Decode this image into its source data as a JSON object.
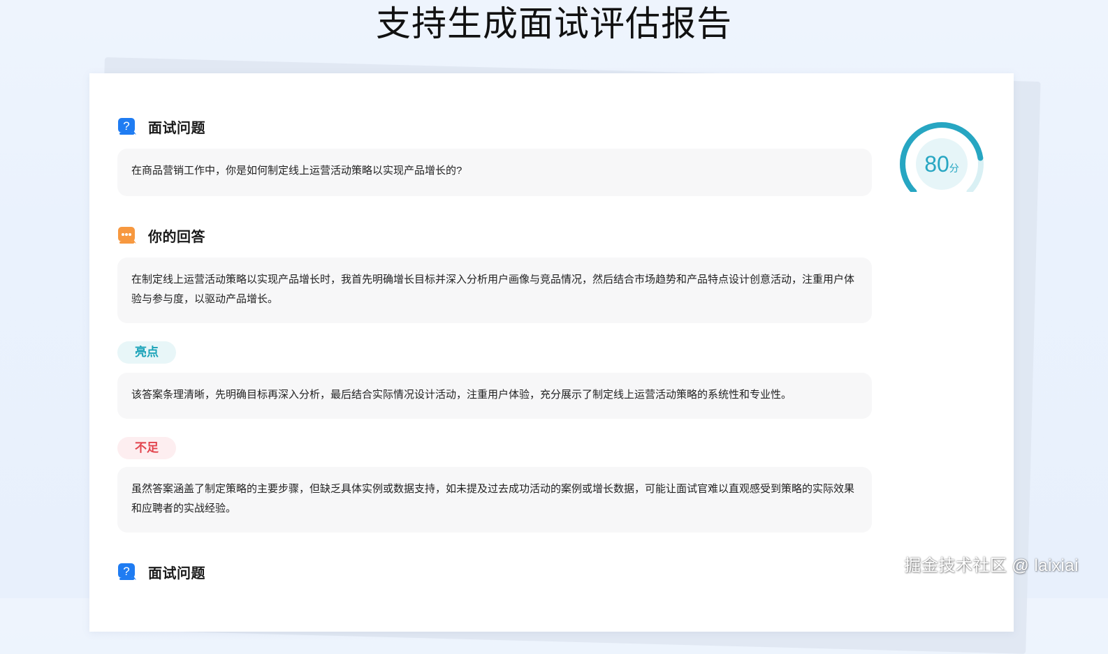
{
  "page": {
    "title": "支持生成面试评估报告"
  },
  "report": {
    "score": {
      "value": "80",
      "unit": "分",
      "fraction": 0.8,
      "color": "#27a6c2"
    },
    "sections": {
      "question_label": "面试问题",
      "question_text": "在商品营销工作中，你是如何制定线上运营活动策略以实现产品增长的?",
      "answer_label": "你的回答",
      "answer_text": "在制定线上运营活动策略以实现产品增长时，我首先明确增长目标并深入分析用户画像与竞品情况，然后结合市场趋势和产品特点设计创意活动，注重用户体验与参与度，以驱动产品增长。",
      "highlight_label": "亮点",
      "highlight_text": "该答案条理清晰，先明确目标再深入分析，最后结合实际情况设计活动，注重用户体验，充分展示了制定线上运营活动策略的系统性和专业性。",
      "shortcoming_label": "不足",
      "shortcoming_text": "虽然答案涵盖了制定策略的主要步骤，但缺乏具体实例或数据支持，如未提及过去成功活动的案例或增长数据，可能让面试官难以直观感受到策略的实际效果和应聘者的实战经验。",
      "next_question_label": "面试问题"
    },
    "icons": {
      "question": "question-bubble-icon",
      "answer": "chat-bubble-icon"
    },
    "colors": {
      "question_icon": "#1f7cf2",
      "answer_icon": "#f7983f",
      "highlight": "#1aa3b8",
      "shortcoming": "#e2444d"
    }
  },
  "watermark": {
    "text": "掘金技术社区 @ laixiai"
  }
}
